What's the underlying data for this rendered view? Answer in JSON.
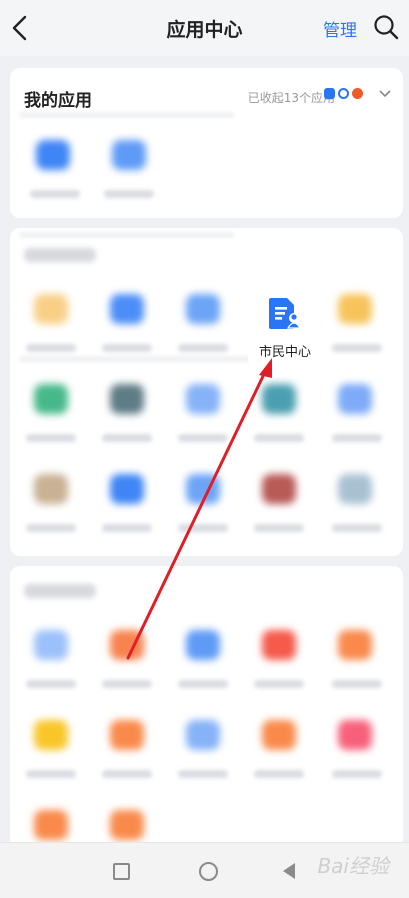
{
  "header": {
    "title": "应用中心",
    "manage_label": "管理"
  },
  "my_apps": {
    "title": "我的应用",
    "collapsed_text": "已收起13个应用",
    "mini_icon_colors": [
      "#2a75f3",
      "#2a75f3",
      "#f05a28"
    ]
  },
  "featured_app": {
    "label": "市民中心",
    "icon": "citizen-doc-icon",
    "color": "#2a75f3"
  },
  "annotation": {
    "type": "red-arrow",
    "color": "#e01e28"
  },
  "watermark": {
    "text": "Bai经验"
  }
}
